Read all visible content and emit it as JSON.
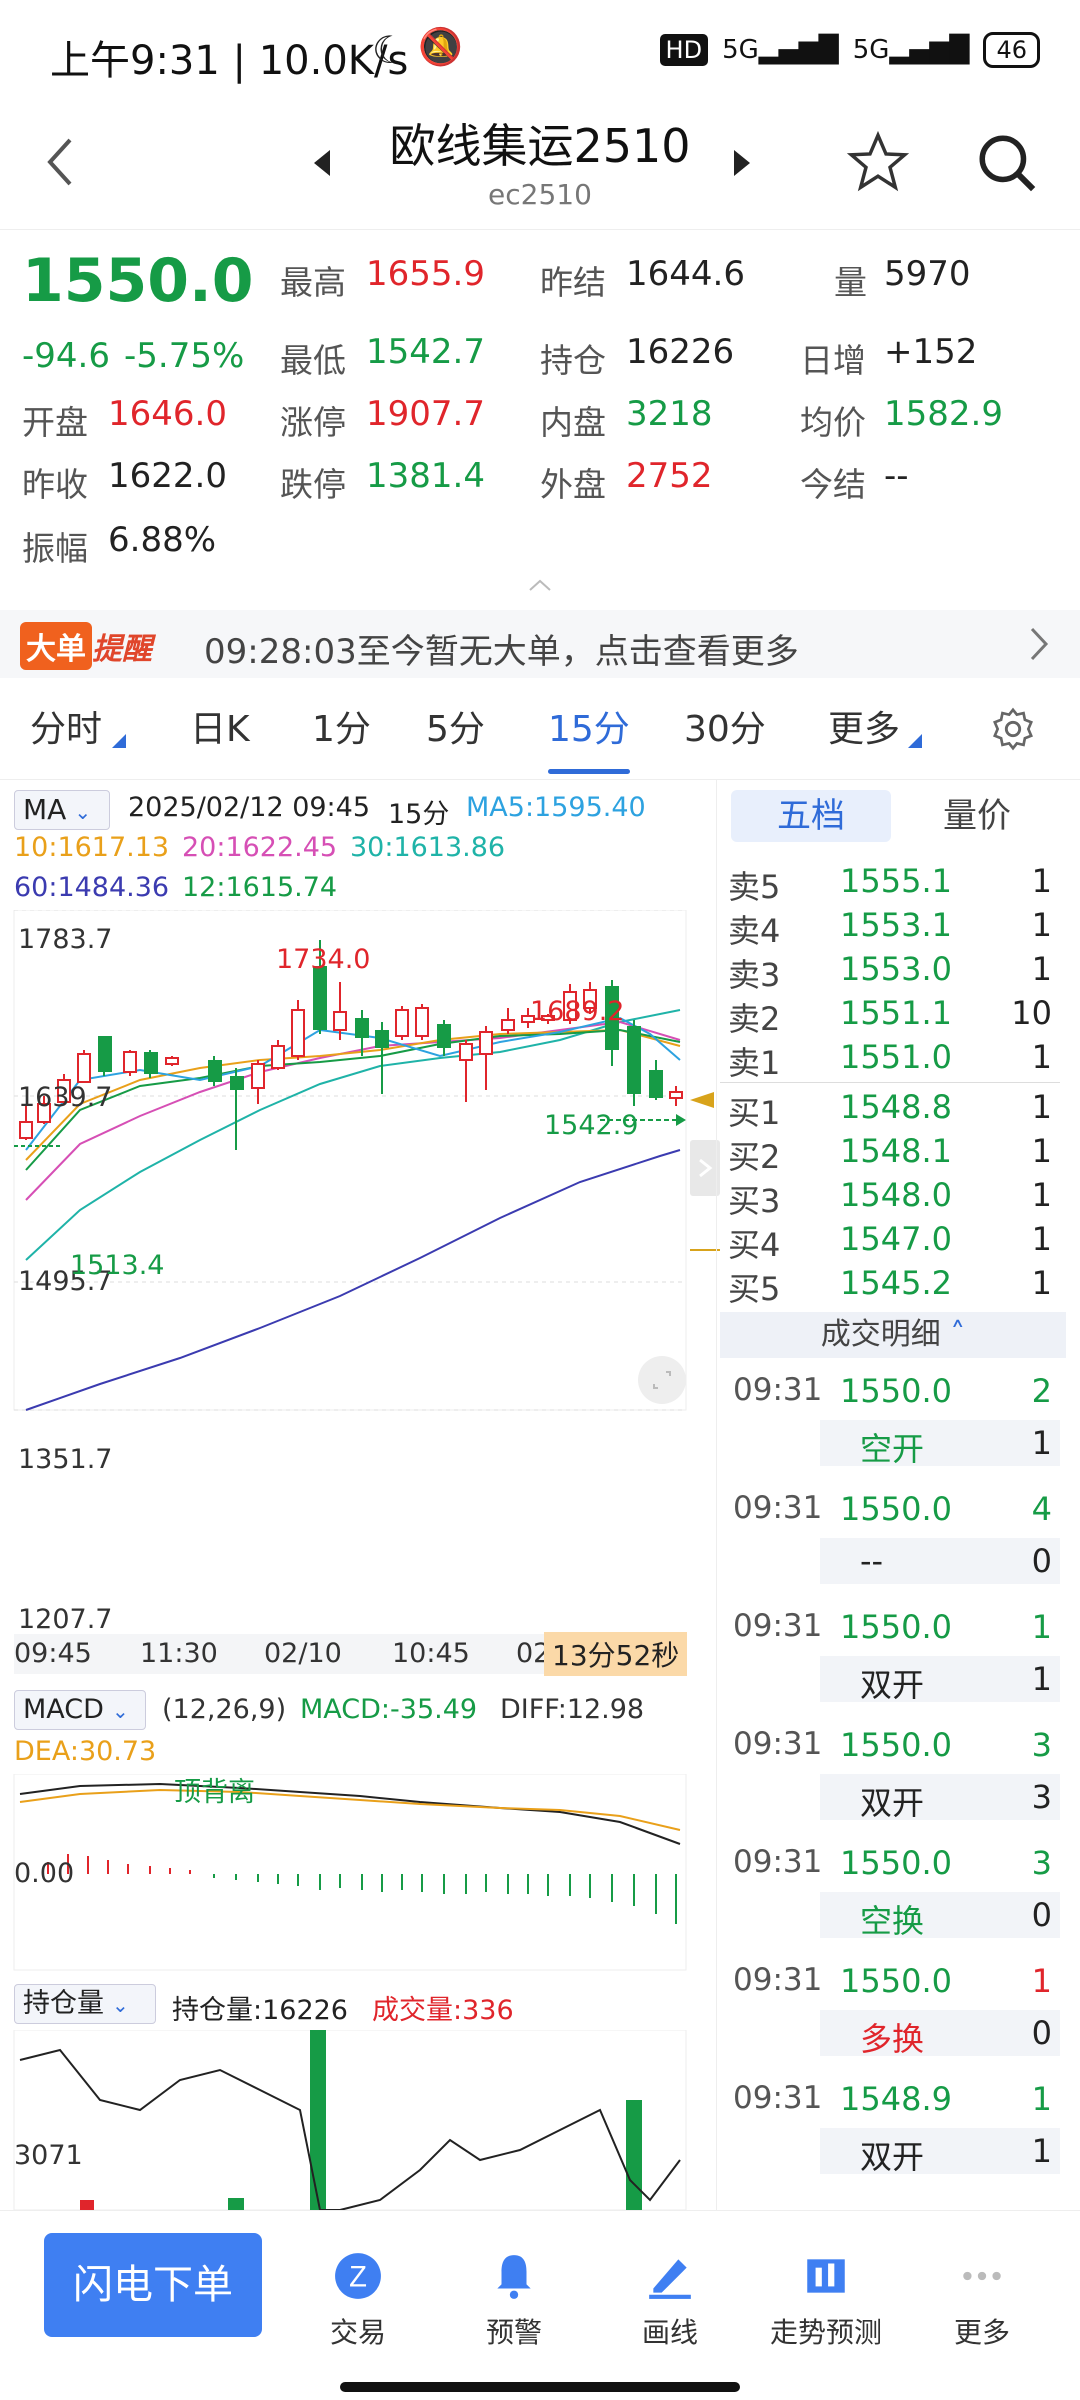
{
  "status_bar": {
    "time": "上午9:31 | 10.0K/s",
    "hd": "HD",
    "signal1": "5G",
    "signal2": "5G",
    "battery": "46"
  },
  "header": {
    "title": "欧线集运2510",
    "code": "ec2510"
  },
  "quote": {
    "last": "1550.0",
    "change": "-94.6",
    "change_pct": "-5.75%",
    "fields": {
      "high_label": "最高",
      "high": "1655.9",
      "prev_settle_label": "昨结",
      "prev_settle": "1644.6",
      "volume_label": "量",
      "volume": "5970",
      "low_label": "最低",
      "low": "1542.7",
      "oi_label": "持仓",
      "oi": "16226",
      "daily_inc_label": "日增",
      "daily_inc": "+152",
      "open_label": "开盘",
      "open": "1646.0",
      "limit_up_label": "涨停",
      "limit_up": "1907.7",
      "inner_label": "内盘",
      "inner": "3218",
      "avg_label": "均价",
      "avg": "1582.9",
      "prev_close_label": "昨收",
      "prev_close": "1622.0",
      "limit_down_label": "跌停",
      "limit_down": "1381.4",
      "outer_label": "外盘",
      "outer": "2752",
      "today_settle_label": "今结",
      "today_settle": "--",
      "amplitude_label": "振幅",
      "amplitude": "6.88%"
    }
  },
  "big_order": {
    "badge1": "大单",
    "badge2": "提醒",
    "text": "09:28:03至今暂无大单，点击查看更多"
  },
  "tabs": [
    {
      "label": "分时"
    },
    {
      "label": "日K"
    },
    {
      "label": "1分"
    },
    {
      "label": "5分"
    },
    {
      "label": "15分"
    },
    {
      "label": "30分"
    },
    {
      "label": "更多"
    }
  ],
  "chart_header": {
    "indicator": "MA",
    "datetime": "2025/02/12 09:45",
    "period": "15分",
    "ma5": "MA5:1595.40",
    "ma10": "10:1617.13",
    "ma20": "20:1622.45",
    "ma30": "30:1613.86",
    "ma60": "60:1484.36",
    "ma12": "12:1615.74"
  },
  "price_axis": [
    "1783.7",
    "1639.7",
    "1495.7",
    "1351.7",
    "1207.7"
  ],
  "annotations": {
    "high": "1734.0",
    "high2": "1689.2",
    "last_low": "1542.9",
    "left_low": "1513.4"
  },
  "time_axis": [
    "09:45",
    "11:30",
    "02/10",
    "10:45",
    "02"
  ],
  "countdown": "13分52秒",
  "macd": {
    "name": "MACD",
    "params": "(12,26,9)",
    "macd": "MACD:-35.49",
    "diff": "DIFF:12.98",
    "dea": "DEA:30.73",
    "note": "顶背离",
    "zero": "0.00"
  },
  "oi_panel": {
    "name": "持仓量",
    "oi": "持仓量:16226",
    "vol": "成交量:336",
    "axis": "3071"
  },
  "book_tabs": {
    "active": "五档",
    "other": "量价"
  },
  "book": {
    "asks": [
      {
        "label": "卖5",
        "price": "1555.1",
        "vol": "1"
      },
      {
        "label": "卖4",
        "price": "1553.1",
        "vol": "1"
      },
      {
        "label": "卖3",
        "price": "1553.0",
        "vol": "1"
      },
      {
        "label": "卖2",
        "price": "1551.1",
        "vol": "10"
      },
      {
        "label": "卖1",
        "price": "1551.0",
        "vol": "1"
      }
    ],
    "bids": [
      {
        "label": "买1",
        "price": "1548.8",
        "vol": "1"
      },
      {
        "label": "买2",
        "price": "1548.1",
        "vol": "1"
      },
      {
        "label": "买3",
        "price": "1548.0",
        "vol": "1"
      },
      {
        "label": "买4",
        "price": "1547.0",
        "vol": "1"
      },
      {
        "label": "买5",
        "price": "1545.2",
        "vol": "1"
      }
    ]
  },
  "trades_header": "成交明细",
  "trades": [
    {
      "time": "09:31",
      "price": "1550.0",
      "vol": "2",
      "type": "空开",
      "type_vol": "1",
      "color": "#169b46"
    },
    {
      "time": "09:31",
      "price": "1550.0",
      "vol": "4",
      "type": "--",
      "type_vol": "0",
      "color": "#222222"
    },
    {
      "time": "09:31",
      "price": "1550.0",
      "vol": "1",
      "type": "双开",
      "type_vol": "1",
      "color": "#222222"
    },
    {
      "time": "09:31",
      "price": "1550.0",
      "vol": "3",
      "type": "双开",
      "type_vol": "3",
      "color": "#222222"
    },
    {
      "time": "09:31",
      "price": "1550.0",
      "vol": "3",
      "type": "空换",
      "type_vol": "0",
      "color": "#169b46"
    },
    {
      "time": "09:31",
      "price": "1550.0",
      "vol": "1",
      "type": "多换",
      "type_vol": "0",
      "color": "#e0252b"
    },
    {
      "time": "09:31",
      "price": "1548.9",
      "vol": "1",
      "type": "双开",
      "type_vol": "1",
      "color": "#222222"
    }
  ],
  "bottom_nav": {
    "flash": "闪电下单",
    "trade": "交易",
    "alert": "预警",
    "draw": "画线",
    "trend": "走势预测",
    "more": "更多"
  }
}
